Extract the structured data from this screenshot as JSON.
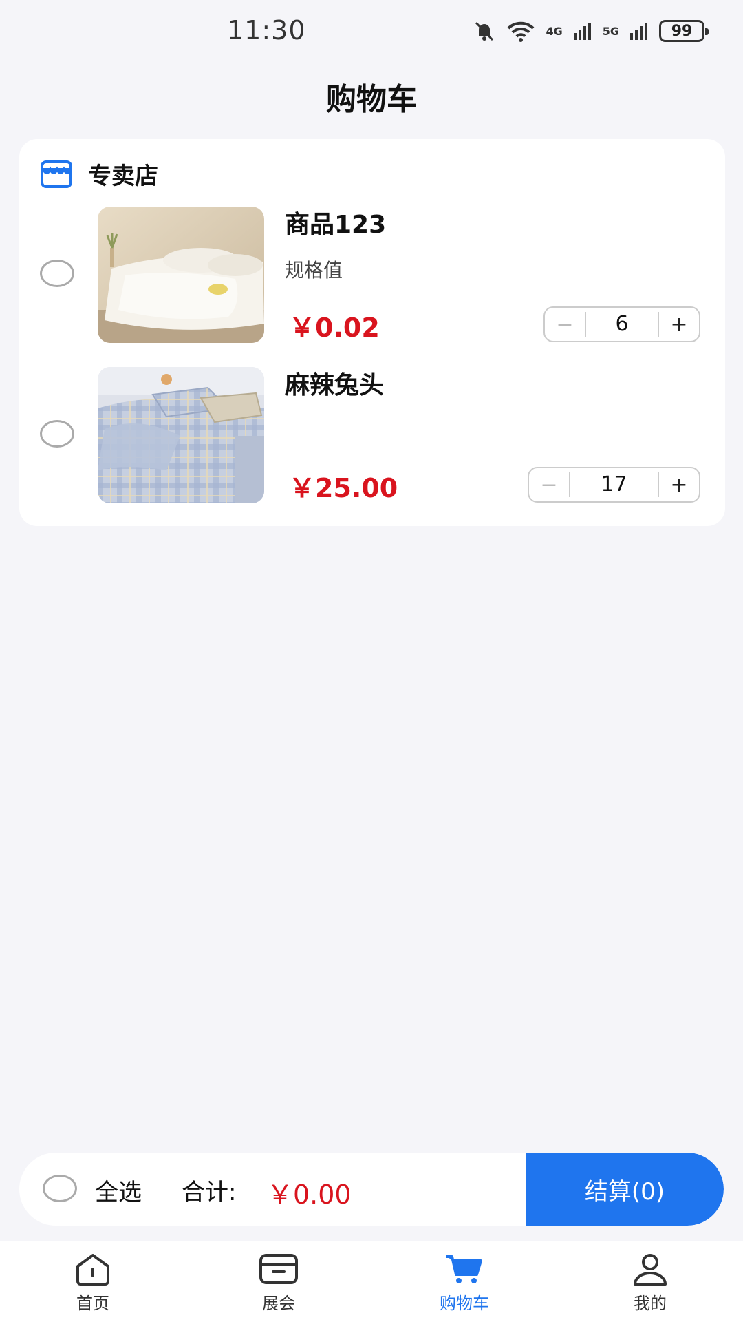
{
  "status_bar": {
    "time": "11:30",
    "signal_4g": "4G",
    "signal_5g": "5G",
    "battery": "99"
  },
  "page_title": "购物车",
  "shop": {
    "name": "专卖店",
    "items": [
      {
        "title": "商品123",
        "spec": "规格值",
        "price": "￥0.02",
        "quantity": "6",
        "minus": "−",
        "plus": "+"
      },
      {
        "title": "麻辣兔头",
        "spec": "",
        "price": "￥25.00",
        "quantity": "17",
        "minus": "−",
        "plus": "+"
      }
    ]
  },
  "checkout": {
    "select_all": "全选",
    "total_label": "合计:",
    "total_value": "￥0.00",
    "button": "结算(0)"
  },
  "tabs": [
    {
      "label": "首页",
      "icon": "home-icon"
    },
    {
      "label": "展会",
      "icon": "box-icon"
    },
    {
      "label": "购物车",
      "icon": "cart-icon",
      "active": true
    },
    {
      "label": "我的",
      "icon": "user-icon"
    }
  ],
  "colors": {
    "accent": "#1f75ee",
    "price": "#d9141e",
    "background": "#f5f5f9"
  }
}
